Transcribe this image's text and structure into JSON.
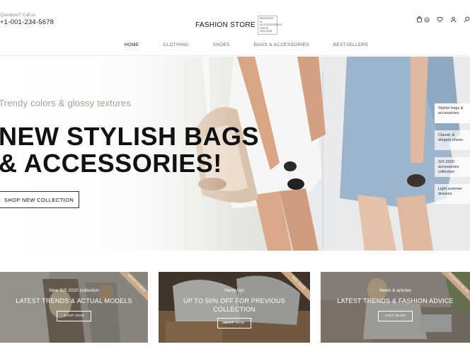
{
  "header": {
    "contact_label": "Questions? Call us",
    "phone": "+1-001-234-5678",
    "logo_text": "FASHION STORE",
    "logo_tag": "FASHION & ACCESSORIES SHOP ONLINE",
    "cart_count": "0"
  },
  "nav": {
    "items": [
      {
        "label": "HOME"
      },
      {
        "label": "CLOTHING"
      },
      {
        "label": "SHOES"
      },
      {
        "label": "BAGS & ACCESSORIES"
      },
      {
        "label": "BESTSELLERS"
      }
    ]
  },
  "hero": {
    "eyebrow": "Trendy colors & glossy textures",
    "title_line1": "NEW STYLISH BAGS",
    "title_line2": "& ACCESSORIES!",
    "button": "SHOP NEW COLLECTION",
    "side_items": [
      {
        "label": "Stylish bags & accessories"
      },
      {
        "label": "Classic & elegant shoes"
      },
      {
        "label": "S/S 2020 accessories collection"
      },
      {
        "label": "Light summer dresses"
      }
    ]
  },
  "promos": [
    {
      "sub": "New S/S 2020 collection",
      "title": "LATEST TRENDS & ACTUAL MODELS",
      "button": "SHOP NOW",
      "ribbon": "WHAT'S NEW"
    },
    {
      "sub": "Hurry Up!",
      "title": "UP TO 50% OFF FOR PREVIOUS COLLECTION",
      "button": "SHOP NOW",
      "ribbon": "BIG SALE"
    },
    {
      "sub": "News & articles",
      "title": "LATEST TRENDS & FASHION ADVICE",
      "button": "VISIT BLOG",
      "ribbon": "FASHION BLOG"
    }
  ],
  "colors": {
    "accent": "#c9a887",
    "eyebrow": "#a89f93",
    "text": "#111111"
  }
}
